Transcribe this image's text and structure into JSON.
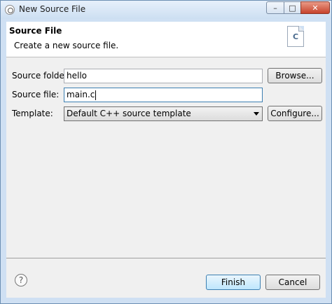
{
  "window": {
    "title": "New Source File",
    "controls": {
      "minimize": "–",
      "maximize": "□",
      "close": "✕"
    }
  },
  "header": {
    "title": "Source File",
    "description": "Create a new source file.",
    "icon_letter": "C"
  },
  "form": {
    "source_folder_label": "Source folder:",
    "source_folder_value": "hello",
    "browse_button": "Browse...",
    "source_file_label": "Source file:",
    "source_file_value": "main.c",
    "template_label": "Template:",
    "template_selected": "Default C++ source template",
    "configure_button": "Configure..."
  },
  "footer": {
    "help_symbol": "?",
    "finish_button": "Finish",
    "cancel_button": "Cancel"
  },
  "icons": [
    "app-icon",
    "file-c-icon",
    "help-icon",
    "chevron-down-icon"
  ]
}
